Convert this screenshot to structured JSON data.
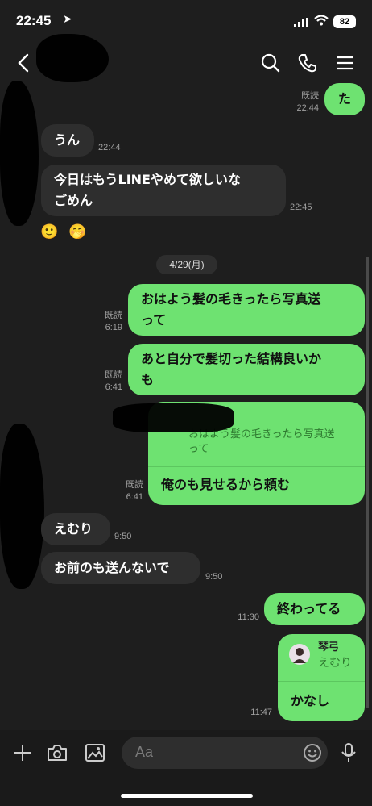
{
  "status_bar": {
    "time": "22:45",
    "battery": "82",
    "icons": [
      "location-arrow-icon",
      "signal-icon",
      "wifi-icon",
      "battery-icon"
    ]
  },
  "header": {
    "icons": [
      "back-icon",
      "search-icon",
      "phone-icon",
      "menu-icon"
    ]
  },
  "messages": {
    "m1": {
      "text": "た",
      "read": "既読",
      "time": "22:44"
    },
    "m2": {
      "text": "うん",
      "time": "22:44"
    },
    "m3": {
      "line1": "今日はもうLINEやめて欲しいな",
      "line2": "ごめん",
      "time": "22:45"
    },
    "date": "4/29(月)",
    "m4": {
      "line1": "おはよう髪の毛きったら写真送",
      "line2": "って",
      "read": "既読",
      "time": "6:19"
    },
    "m5": {
      "line1": "あと自分で髪切った結構良いか",
      "line2": "も",
      "read": "既読",
      "time": "6:41"
    },
    "m6": {
      "quote1": "おはよう髪の毛きったら写真送",
      "quote2": "って",
      "text": "俺のも見せるから頼む",
      "read": "既読",
      "time": "6:41"
    },
    "m7": {
      "text": "えむり",
      "time": "9:50"
    },
    "m8": {
      "text": "お前のも送んないで",
      "time": "9:50"
    },
    "m9": {
      "text": "終わってる",
      "time": "11:30"
    },
    "m10": {
      "quote_name": "琴弓",
      "quote_text": "えむり",
      "text": "かなし",
      "time": "11:47"
    }
  },
  "composer": {
    "placeholder": "Aa",
    "icons": [
      "plus-icon",
      "camera-icon",
      "image-icon",
      "emoji-icon",
      "mic-icon"
    ]
  },
  "colors": {
    "background": "#1e1e1e",
    "outgoing_bubble": "#6ee271",
    "incoming_bubble": "#2e2e2e"
  }
}
